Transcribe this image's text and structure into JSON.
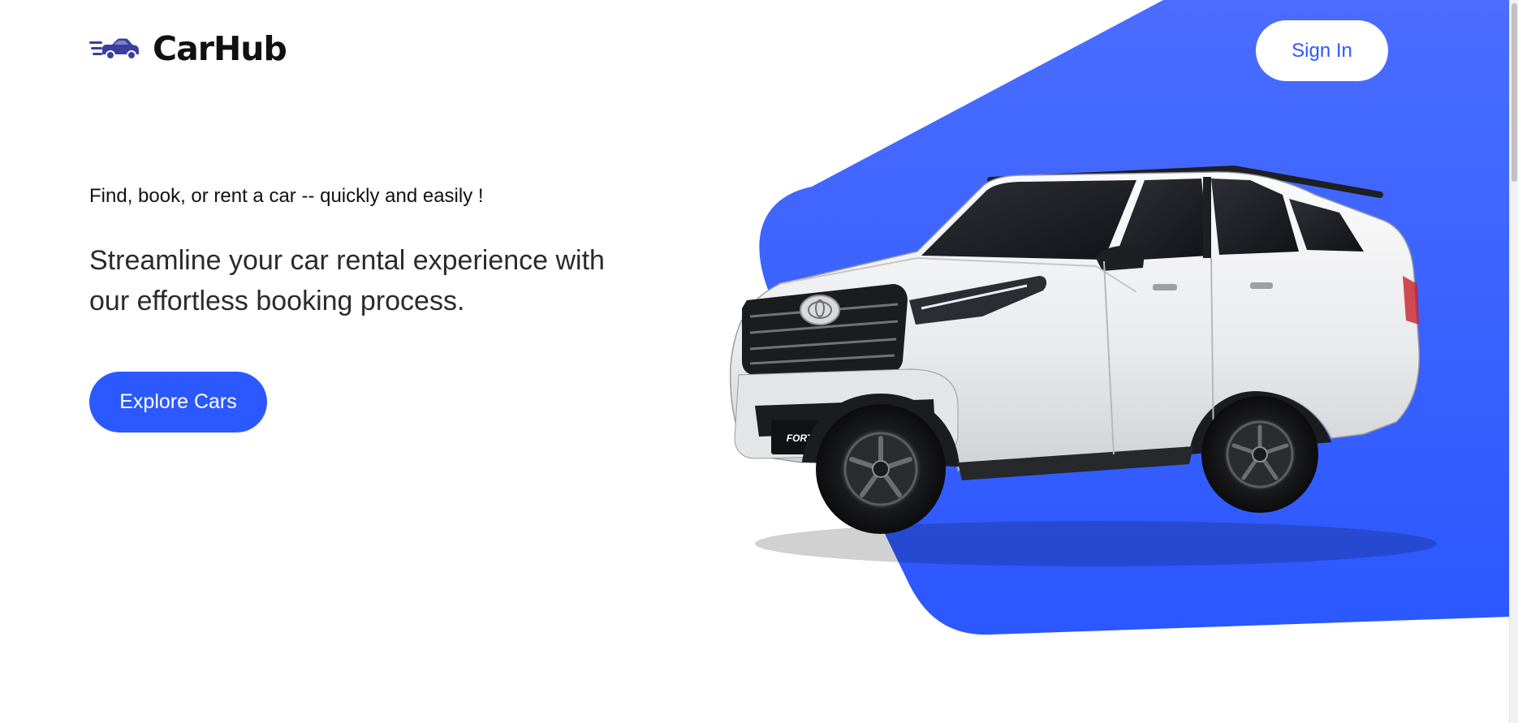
{
  "header": {
    "brand": "CarHub",
    "logo_icon": "car-speed-icon",
    "sign_in_label": "Sign In"
  },
  "hero": {
    "tagline": "Find, book, or rent a car -- quickly and easily !",
    "subtitle": "Streamline your car rental experience with our effortless booking process.",
    "cta_label": "Explore Cars",
    "car_plate_text": "FORTUNER"
  },
  "colors": {
    "accent": "#2b59ff",
    "accent_light": "#4a6bff",
    "text": "#111111",
    "background": "#ffffff"
  }
}
